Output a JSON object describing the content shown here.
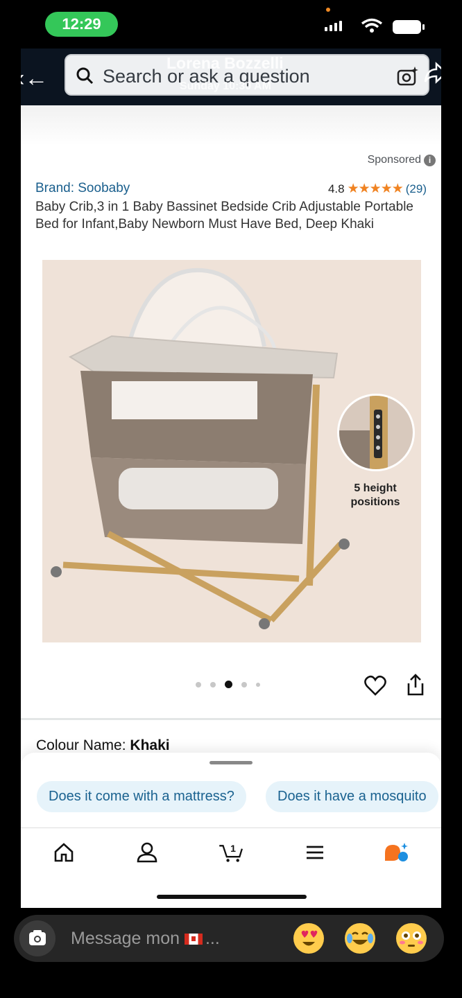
{
  "status": {
    "time": "12:29"
  },
  "story": {
    "name": "Lorena Bozzelli",
    "subtitle": "Sunday 10:30 AM"
  },
  "search": {
    "placeholder": "Search or ask a question"
  },
  "listing": {
    "sponsored": "Sponsored",
    "brand": "Brand: Soobaby",
    "rating": "4.8",
    "stars": "★★★★★",
    "rating_count": "(29)",
    "title": "Baby Crib,3 in 1 Baby Bassinet Bedside Crib Adjustable Portable Bed for Infant,Baby Newborn Must Have Bed, Deep Khaki",
    "image_label_line1": "5 height",
    "image_label_line2": "positions",
    "carousel": {
      "count": 5,
      "active_index": 2
    },
    "colour_label": "Colour Name:",
    "colour_value": "Khaki"
  },
  "suggestions": [
    "Does it come with a mattress?",
    "Does it have a mosquito"
  ],
  "bottom_nav": {
    "items": [
      "home-icon",
      "account-icon",
      "cart-icon",
      "menu-icon",
      "rufus-icon"
    ],
    "cart_count": "1"
  },
  "dm": {
    "placeholder": "Message mon",
    "ellipsis": "..."
  },
  "emojis": [
    "heart-eyes",
    "tears-of-joy",
    "flushed"
  ]
}
